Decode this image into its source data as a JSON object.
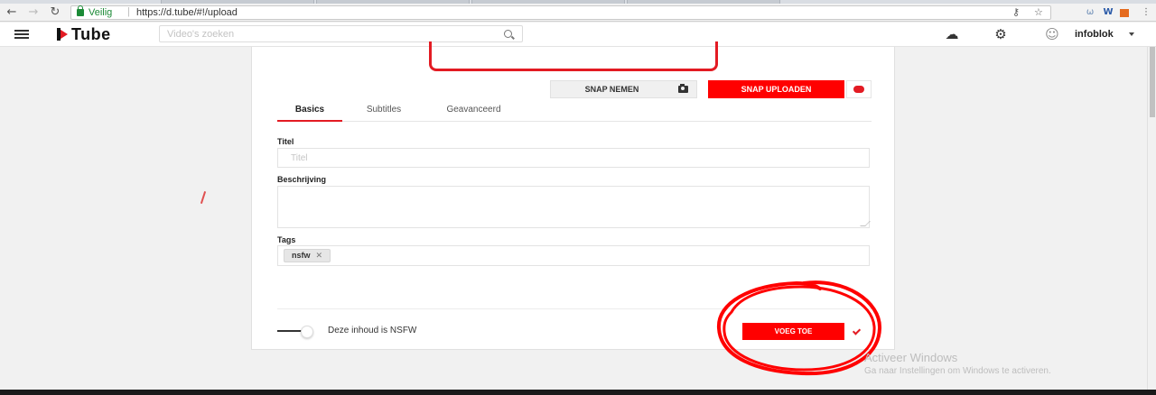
{
  "browser": {
    "secure_label": "Veilig",
    "url": "https://d.tube/#!/upload"
  },
  "header": {
    "logo_text": "Tube",
    "search_placeholder": "Video's zoeken",
    "username": "infoblok"
  },
  "upload": {
    "snap_take_label": "SNAP NEMEN",
    "snap_upload_label": "SNAP UPLOADEN",
    "tabs": [
      {
        "label": "Basics",
        "active": true
      },
      {
        "label": "Subtitles",
        "active": false
      },
      {
        "label": "Geavanceerd",
        "active": false
      }
    ],
    "title_label": "Titel",
    "title_placeholder": "Titel",
    "title_value": "",
    "description_label": "Beschrijving",
    "description_value": "",
    "tags_label": "Tags",
    "tags": [
      "nsfw"
    ],
    "nsfw_toggle_on": false,
    "nsfw_label": "Deze inhoud is NSFW",
    "add_button_label": "VOEG TOE"
  },
  "overlay": {
    "watermark_title": "Activeer Windows",
    "watermark_sub": "Ga naar Instellingen om Windows te activeren."
  },
  "colors": {
    "accent": "#ff0000",
    "brand_red": "#e31b23",
    "secure_green": "#1b8a36"
  }
}
